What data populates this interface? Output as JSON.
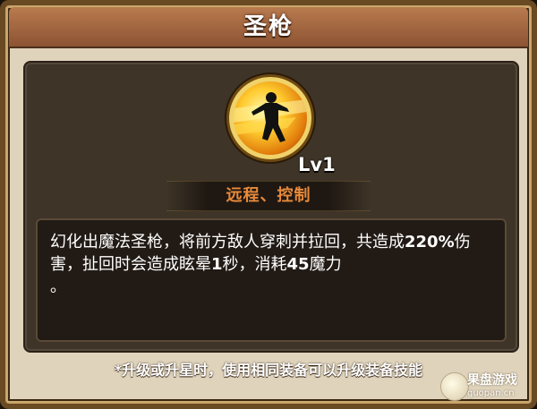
{
  "title": "圣枪",
  "skill": {
    "icon": "spear-warrior-icon",
    "level": "Lv1",
    "tags": "远程、控制"
  },
  "description": {
    "part1": "幻化出魔法圣枪，将前方敌人穿刺并拉回，共造成",
    "damage": "220%",
    "part2": "伤害，扯回时会造成眩晕",
    "stun": "1",
    "part3": "秒，消耗",
    "mana": "45",
    "part4": "魔力",
    "part5": "。"
  },
  "footer": "*升级或升星时，使用相同装备可以升级装备技能",
  "watermark": {
    "name": "果盘游戏",
    "url": "guopan.cn"
  },
  "colors": {
    "title_bar": "#a4653f",
    "tag_text": "#e88a3a",
    "panel": "#3e3427",
    "icon_ring": "#f0d26a"
  }
}
